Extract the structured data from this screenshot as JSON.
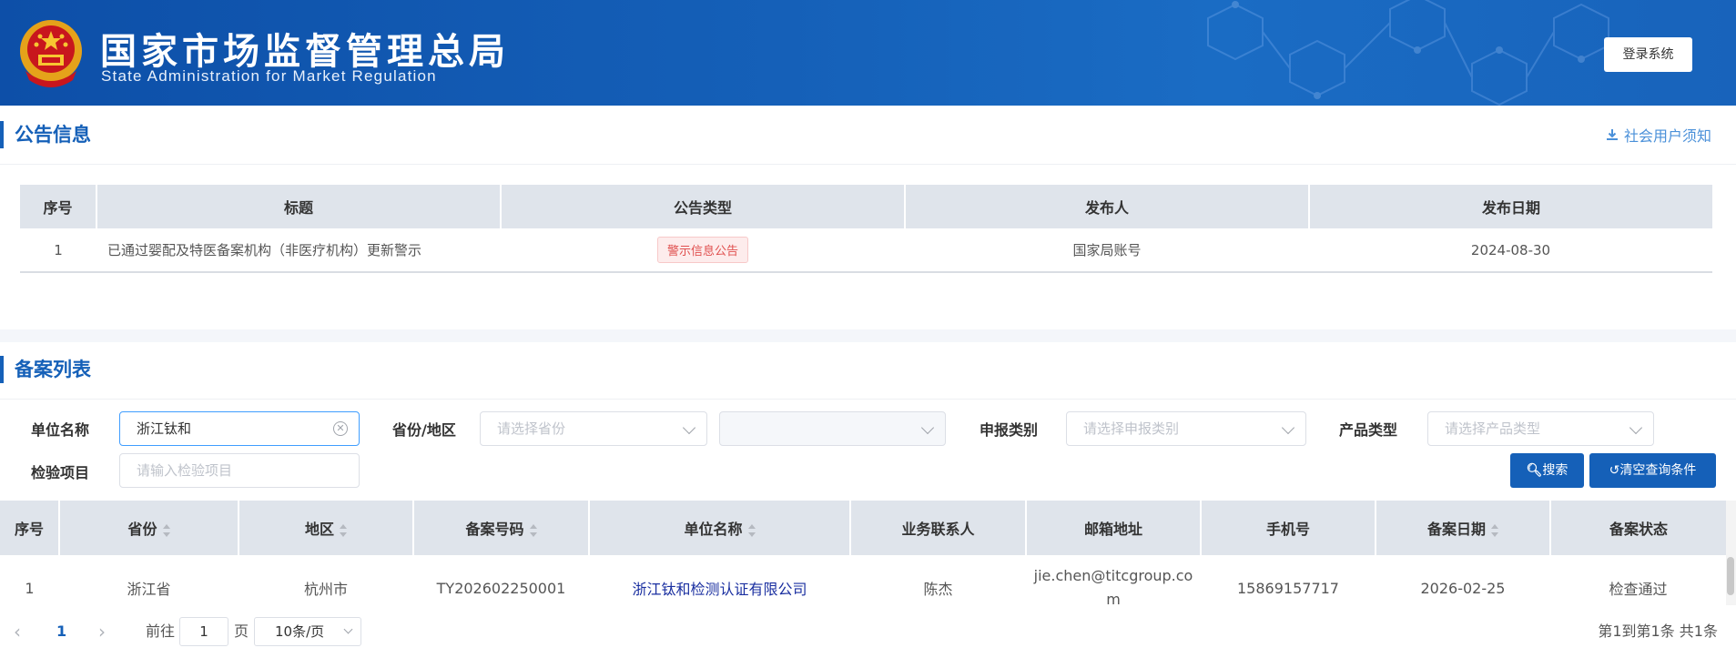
{
  "header": {
    "title_cn": "国家市场监督管理总局",
    "title_en": "State Administration  for  Market Regulation",
    "login_label": "登录系统"
  },
  "announcement": {
    "section_title": "公告信息",
    "notice_link": "社会用户须知",
    "columns": [
      "序号",
      "标题",
      "公告类型",
      "发布人",
      "发布日期"
    ],
    "rows": [
      {
        "no": "1",
        "title": "已通过婴配及特医备案机构（非医疗机构）更新警示",
        "type": "警示信息公告",
        "publisher": "国家局账号",
        "date": "2024-08-30"
      }
    ]
  },
  "records": {
    "section_title": "备案列表",
    "filters": {
      "unit_label": "单位名称",
      "unit_value": "浙江钛和",
      "province_label": "省份/地区",
      "province_placeholder": "请选择省份",
      "region_placeholder": "",
      "declare_label": "申报类别",
      "declare_placeholder": "请选择申报类别",
      "product_label": "产品类型",
      "product_placeholder": "请选择产品类型",
      "item_label": "检验项目",
      "item_placeholder": "请输入检验项目",
      "search_label": "搜索",
      "clear_label": "清空查询条件"
    },
    "columns": [
      "序号",
      "省份",
      "地区",
      "备案号码",
      "单位名称",
      "业务联系人",
      "邮箱地址",
      "手机号",
      "备案日期",
      "备案状态"
    ],
    "rows": [
      {
        "no": "1",
        "province": "浙江省",
        "region": "杭州市",
        "record_no": "TY202602250001",
        "unit": "浙江钛和检测认证有限公司",
        "contact": "陈杰",
        "email_line1": "jie.chen@titcgroup.co",
        "email_line2": "m",
        "phone": "15869157717",
        "date": "2026-02-25",
        "status": "检查通过"
      }
    ]
  },
  "pagination": {
    "current_page": "1",
    "goto_prefix": "前往",
    "goto_value": "1",
    "goto_suffix": "页",
    "page_size": "10条/页",
    "summary": "第1到第1条 共1条"
  },
  "colors": {
    "primary": "#1560b8",
    "tag_red": "#e0504f",
    "link": "#1a2fa0"
  }
}
